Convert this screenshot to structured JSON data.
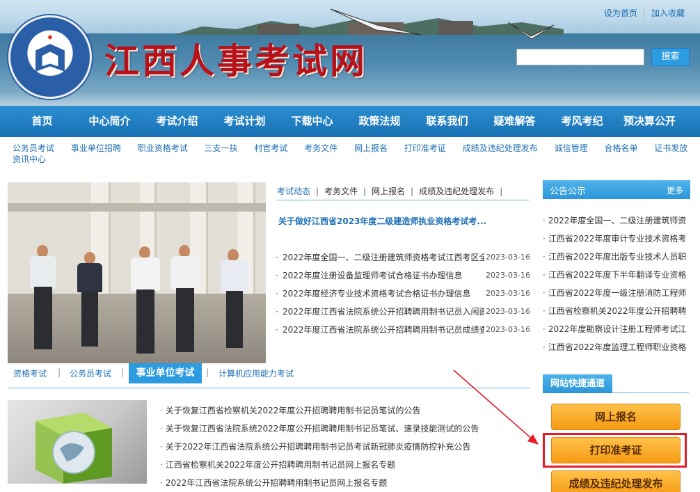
{
  "header": {
    "site_title": "江西人事考试网",
    "top_links": [
      "设为首页",
      "加入收藏"
    ],
    "search_placeholder": "",
    "search_button": "搜索"
  },
  "main_nav": [
    "首页",
    "中心简介",
    "考试介绍",
    "考试计划",
    "下载中心",
    "政策法规",
    "联系我们",
    "疑难解答",
    "考风考纪",
    "预决算公开"
  ],
  "sub_nav": {
    "row1": [
      "公务员考试",
      "事业单位招聘",
      "职业资格考试",
      "三支一扶",
      "村官考试",
      "考务文件",
      "网上报名",
      "打印准考证",
      "成绩及违纪处理发布",
      "诚信管理",
      "合格名单",
      "证书发放"
    ],
    "row2": [
      "资讯中心"
    ]
  },
  "news": {
    "tabs": [
      "考试动态",
      "考务文件",
      "网上报名",
      "成绩及违纪处理发布"
    ],
    "headline": "关于做好江西省2023年度二级建造师执业资格考试考...",
    "items": [
      {
        "text": "2022年度全国一、二级注册建筑师资格考试江西考区全",
        "date": "2023-03-16"
      },
      {
        "text": "2022年度注册设备监理师考试合格证书办理信息",
        "date": "2023-03-16"
      },
      {
        "text": "2022年度经济专业技术资格考试合格证书办理信息",
        "date": "2023-03-16"
      },
      {
        "text": "2022年度江西省法院系统公开招聘聘用制书记员入闱面",
        "date": "2023-03-16"
      },
      {
        "text": "2022年度江西省法院系统公开招聘聘用制书记员成绩查",
        "date": "2023-03-16"
      }
    ]
  },
  "exam_tabs": {
    "items": [
      "资格考试",
      "公务员考试",
      "事业单位考试",
      "计算机应用能力考试"
    ],
    "active": "事业单位考试"
  },
  "announcements": [
    "关于恢复江西省检察机关2022年度公开招聘聘用制书记员笔试的公告",
    "关于恢复江西省法院系统2022年度公开招聘聘用制书记员笔试、速录技能测试的公告",
    "关于2022年江西省法院系统公开招聘聘用制书记员考试新冠肺炎疫情防控补充公告",
    "江西省检察机关2022年度公开招聘聘用制书记员网上报名专题",
    "2022年江西省法院系统公开招聘聘用制书记员网上报名专题"
  ],
  "notice": {
    "title": "公告公示",
    "more": "更多",
    "items": [
      "2022年度全国一、二级注册建筑师资",
      "江西省2022年度审计专业技术资格考",
      "江西省2022年度出版专业技术人员职",
      "江西省2022年度下半年翻译专业资格",
      "江西省2022年度一级注册消防工程师",
      "江西省检察机关2022年度公开招聘聘",
      "2022年度勘察设计注册工程师考试江",
      "江西省2022年度监理工程师职业资格"
    ]
  },
  "quick": {
    "title": "网站快捷通道",
    "buttons": [
      "网上报名",
      "打印准考证",
      "成绩及违纪处理发布"
    ]
  },
  "colors": {
    "nav_blue": "#1a70b5",
    "accent_blue": "#2c9be0",
    "title_red": "#b8111a",
    "button_orange": "#f59a12",
    "highlight_red": "#e51a24"
  }
}
